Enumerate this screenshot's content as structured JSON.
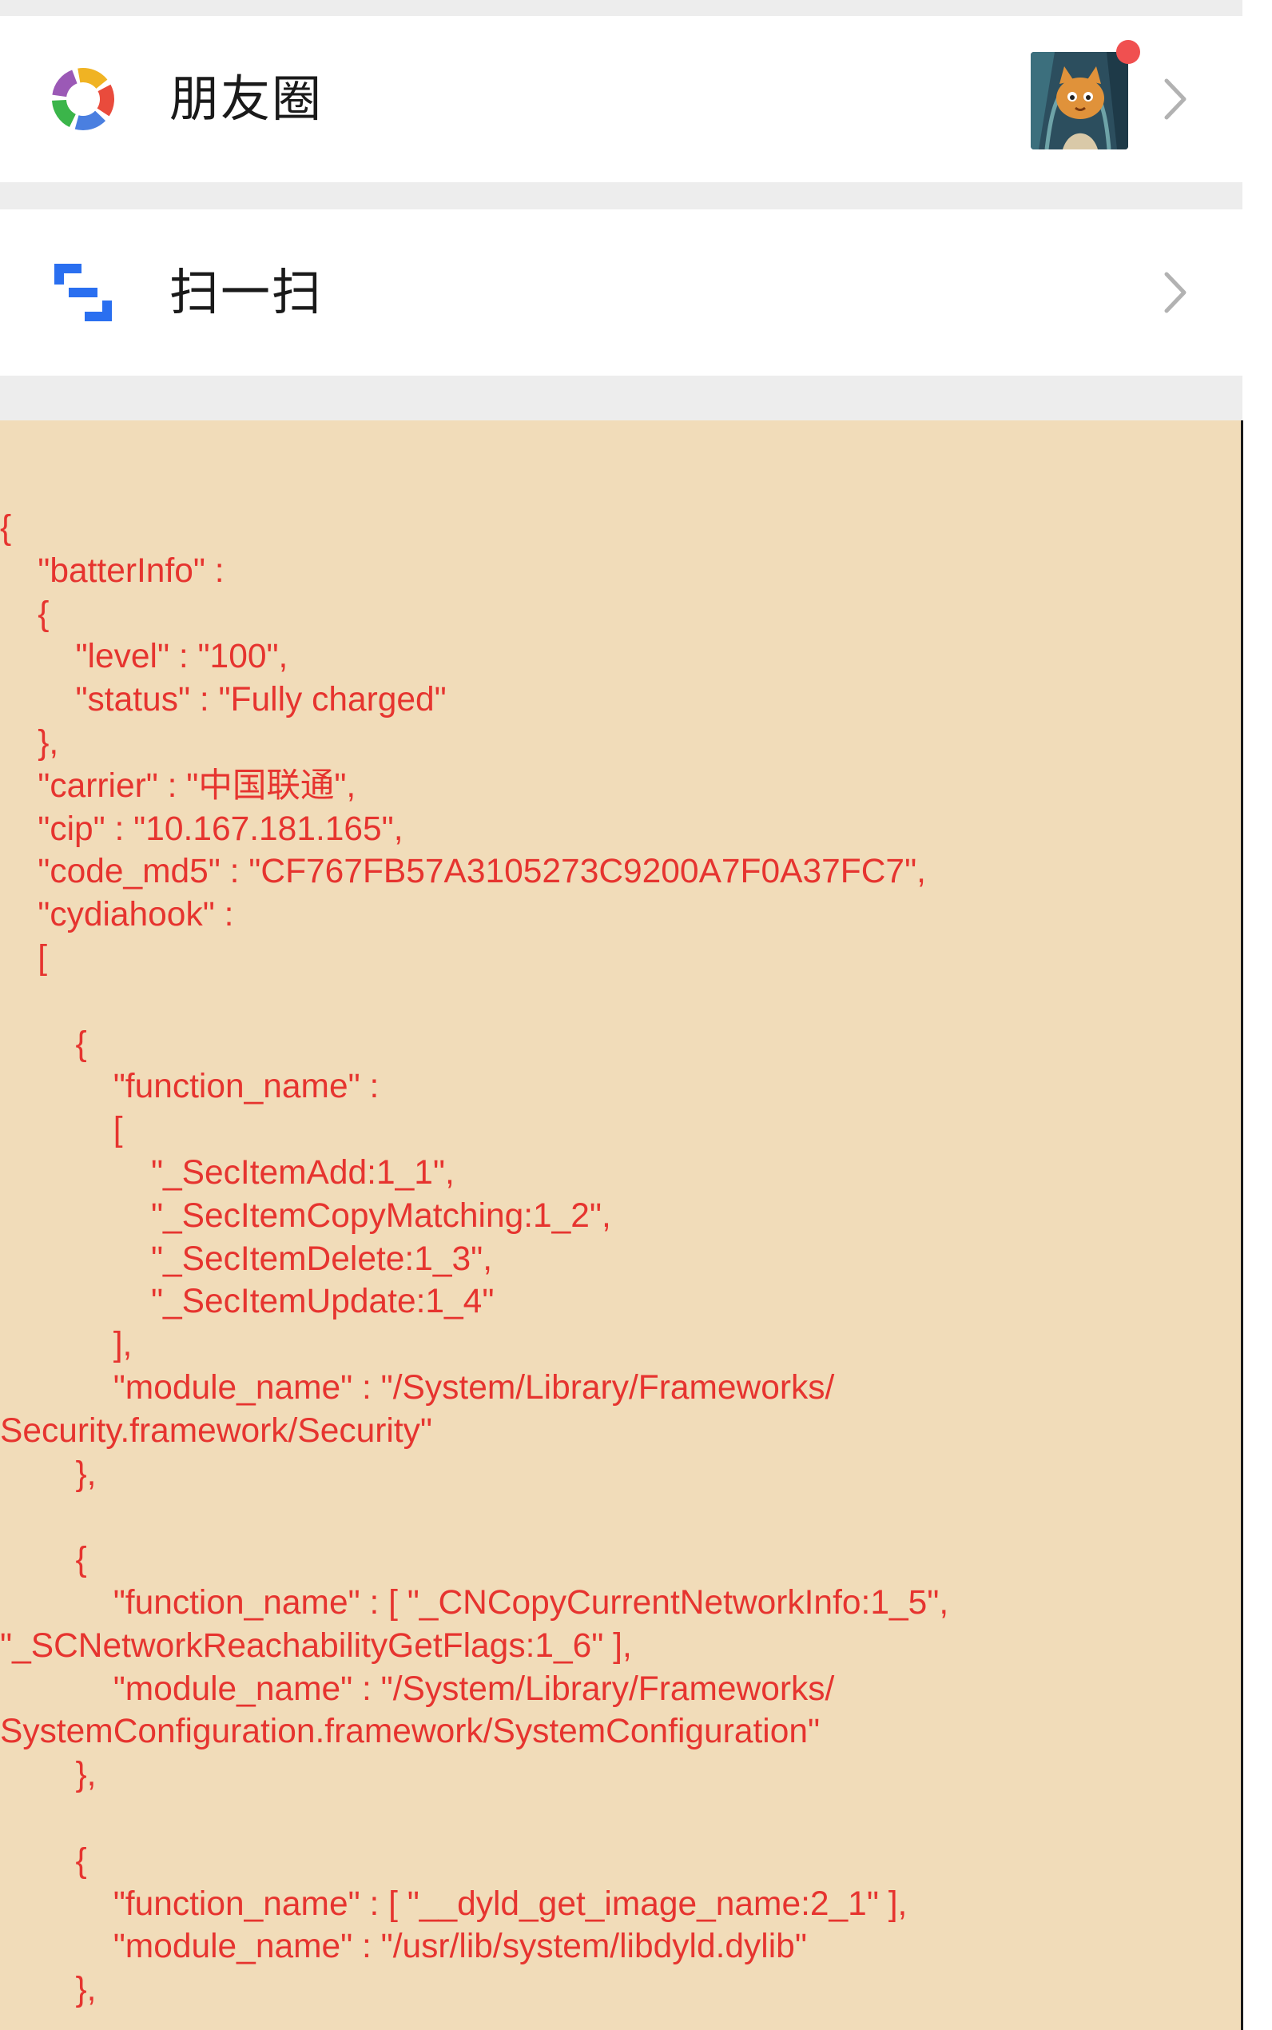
{
  "menu": {
    "moments": {
      "label": "朋友圈",
      "icon": "moments-aperture-icon",
      "has_new_dot": true
    },
    "scan": {
      "label": "扫一扫",
      "icon": "scan-icon"
    }
  },
  "code_panel": {
    "lines": [
      "{",
      "\t\"batterInfo\" :",
      "\t{",
      "\t\t\"level\" : \"100\",",
      "\t\t\"status\" : \"Fully charged\"",
      "\t},",
      "\t\"carrier\" : \"中国联通\",",
      "\t\"cip\" : \"10.167.181.165\",",
      "\t\"code_md5\" : \"CF767FB57A3105273C9200A7F0A37FC7\",",
      "\t\"cydiahook\" :",
      "\t[",
      "",
      "\t\t{",
      "\t\t\t\"function_name\" :",
      "\t\t\t[",
      "\t\t\t\t\"_SecItemAdd:1_1\",",
      "\t\t\t\t\"_SecItemCopyMatching:1_2\",",
      "\t\t\t\t\"_SecItemDelete:1_3\",",
      "\t\t\t\t\"_SecItemUpdate:1_4\"",
      "\t\t\t],",
      "\t\t\t\"module_name\" : \"/System/Library/Frameworks/",
      "Security.framework/Security\"",
      "\t\t},",
      "",
      "\t\t{",
      "\t\t\t\"function_name\" : [ \"_CNCopyCurrentNetworkInfo:1_5\",",
      "\"_SCNetworkReachabilityGetFlags:1_6\" ],",
      "\t\t\t\"module_name\" : \"/System/Library/Frameworks/",
      "SystemConfiguration.framework/SystemConfiguration\"",
      "\t\t},",
      "",
      "\t\t{",
      "\t\t\t\"function_name\" : [ \"__dyld_get_image_name:2_1\" ],",
      "\t\t\t\"module_name\" : \"/usr/lib/system/libdyld.dylib\"",
      "\t\t},"
    ]
  }
}
